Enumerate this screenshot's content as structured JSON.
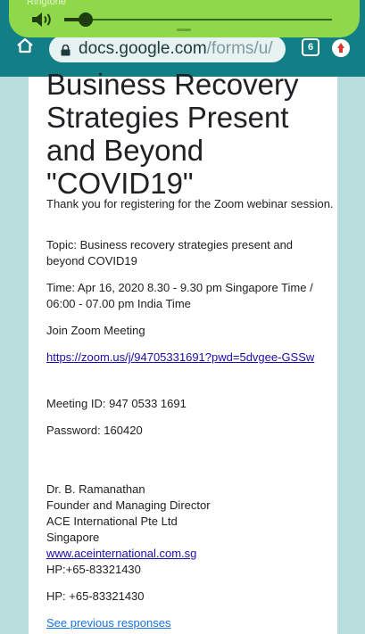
{
  "status_overlay": {
    "ringtone_label": "Ringtone",
    "volume_percent": 8
  },
  "browser": {
    "url_host": "docs.google.com",
    "url_path": "/forms/u/",
    "tab_count": "6"
  },
  "form": {
    "title": "Business Recovery Strategies Present and Beyond \"COVID19\"",
    "paragraphs": {
      "thanks": "Thank you for registering for the Zoom webinar session.",
      "topic": "Topic: Business recovery strategies present and beyond COVID19",
      "time": "Time: Apr 16, 2020 8.30 - 9.30 pm Singapore Time / 06:00 - 07.00 pm India Time",
      "join": "Join Zoom Meeting",
      "zoom_link": "https://zoom.us/j/94705331691?pwd=5dvgee-GSSw",
      "meeting_id": "Meeting ID: 947 0533 1691",
      "password": "Password: 160420"
    },
    "signature": {
      "name": "Dr. B. Ramanathan",
      "role": "Founder and Managing Director",
      "company": "ACE International Pte Ltd",
      "country": "Singapore",
      "website": "www.aceinternational.com.sg",
      "hp1": "HP:+65-83321430",
      "hp2": "HP: +65-83321430"
    },
    "previous_responses_label": "See previous responses"
  }
}
